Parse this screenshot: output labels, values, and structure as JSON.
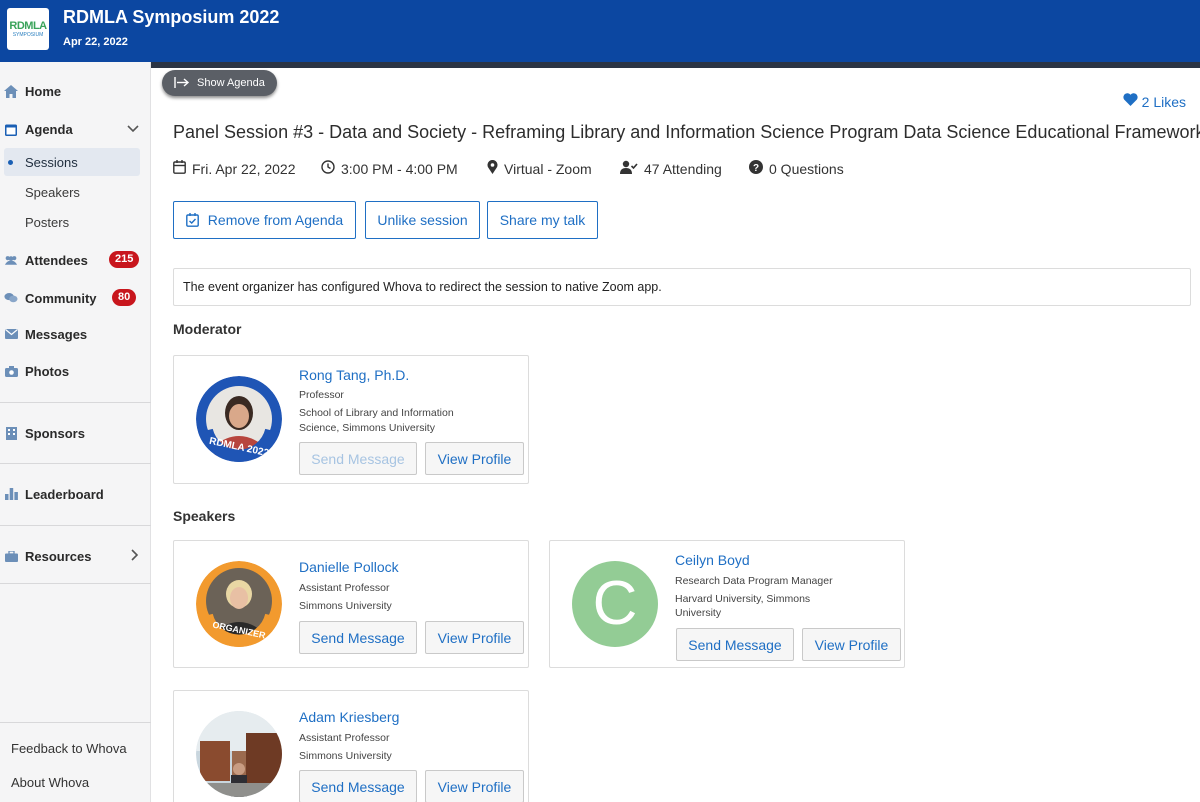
{
  "header": {
    "logo_text_1": "RDMLA",
    "logo_text_2": "SYMPOSIUM",
    "title": "RDMLA Symposium 2022",
    "date": "Apr 22, 2022"
  },
  "sidebar": {
    "home": "Home",
    "agenda": "Agenda",
    "sessions": "Sessions",
    "speakers": "Speakers",
    "posters": "Posters",
    "attendees": "Attendees",
    "attendees_count": "215",
    "community": "Community",
    "community_count": "80",
    "messages": "Messages",
    "photos": "Photos",
    "sponsors": "Sponsors",
    "leaderboard": "Leaderboard",
    "resources": "Resources",
    "feedback": "Feedback to Whova",
    "about": "About Whova"
  },
  "main": {
    "show_agenda": "Show Agenda",
    "likes": "2 Likes",
    "session_title": "Panel Session #3 - Data and Society - Reframing Library and Information Science Program Data Science Educational Framework",
    "meta": {
      "date": "Fri. Apr 22, 2022",
      "time": "3:00 PM - 4:00 PM",
      "location": "Virtual - Zoom",
      "attending": "47 Attending",
      "questions": "0 Questions"
    },
    "actions": {
      "remove": "Remove from Agenda",
      "unlike": "Unlike session",
      "share": "Share my talk"
    },
    "notice": "The event organizer has configured Whova to redirect the session to native Zoom app.",
    "moderator_heading": "Moderator",
    "speakers_heading": "Speakers",
    "send_message": "Send Message",
    "view_profile": "View Profile",
    "moderator": {
      "name": "Rong Tang, Ph.D.",
      "title": "Professor",
      "org": "School of Library and Information Science, Simmons University",
      "ring_text": "RDMLA 2022"
    },
    "speakers": [
      {
        "name": "Danielle Pollock",
        "title": "Assistant Professor",
        "org": "Simmons University",
        "ring_text": "ORGANIZER"
      },
      {
        "name": "Ceilyn Boyd",
        "title": "Research Data Program Manager",
        "org": "Harvard University, Simmons University",
        "initial": "C"
      },
      {
        "name": "Adam Kriesberg",
        "title": "Assistant Professor",
        "org": "Simmons University"
      }
    ]
  },
  "colors": {
    "header": "#0c47a1",
    "accent": "#1f6fc4",
    "badge": "#c8161d",
    "avatar_green": "#93cc95"
  }
}
